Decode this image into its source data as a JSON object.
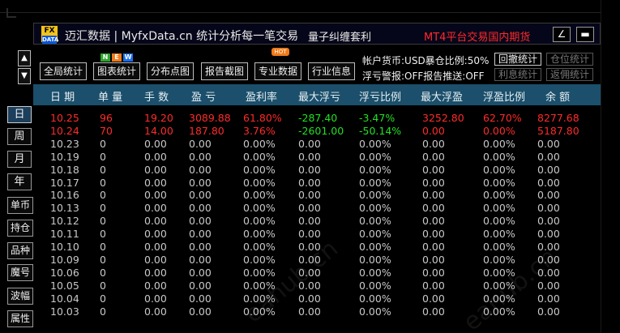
{
  "titlebar": {
    "logo_top": "FX",
    "logo_bottom": "DATA",
    "title": "迈汇数据 | MyfxData.cn  统计分析每一笔交易",
    "quant": "量子纠缠套利",
    "mt4": "MT4平台交易国内期货",
    "btn_edit_icon": "∠",
    "btn_min_icon": "▬"
  },
  "toolbar": {
    "buttons": [
      "全局统计",
      "图表统计",
      "分布点图",
      "报告截图",
      "专业数据",
      "行业信息"
    ],
    "badge_n": "N",
    "badge_e": "E",
    "badge_w": "W",
    "badge_hot": "HOT",
    "info_line1": "帐户货币:USD暴仓比例:50%",
    "info_line2": "浮亏警报:OFF报告推送:OFF",
    "btn_hui_che": "回撤统计",
    "btn_cang_wei": "仓位统计",
    "btn_li_xi": "利息统计",
    "btn_fan_yong": "返佣统计",
    "arrow_up": "▲",
    "arrow_down": "▼"
  },
  "sidebar": {
    "tabs": [
      "日",
      "周",
      "月",
      "年",
      "单币",
      "持仓",
      "品种",
      "魔号",
      "波幅",
      "属性"
    ]
  },
  "table": {
    "headers": [
      "日 期",
      "单 量",
      "手 数",
      "盈 亏",
      "盈利率",
      "最大浮亏",
      "浮亏比例",
      "最大浮盈",
      "浮盈比例",
      "余 额"
    ],
    "rows": [
      {
        "date": "10.25",
        "orders": "96",
        "lots": "19.20",
        "pnl": "3089.88",
        "rate": "61.80%",
        "maxloss": "-287.40",
        "lossratio": "-3.47%",
        "maxprofit": "3252.80",
        "profitratio": "62.70%",
        "balance": "8277.68"
      },
      {
        "date": "10.24",
        "orders": "70",
        "lots": "14.00",
        "pnl": "187.80",
        "rate": "3.76%",
        "maxloss": "-2601.00",
        "lossratio": "-50.14%",
        "maxprofit": "0.00",
        "profitratio": "0.00%",
        "balance": "5187.80"
      },
      {
        "date": "10.23",
        "orders": "0",
        "lots": "0.00",
        "pnl": "0.00",
        "rate": "0.00%",
        "maxloss": "0.00",
        "lossratio": "0.00%",
        "maxprofit": "0.00",
        "profitratio": "0.00%",
        "balance": "0.00"
      },
      {
        "date": "10.19",
        "orders": "0",
        "lots": "0.00",
        "pnl": "0.00",
        "rate": "0.00%",
        "maxloss": "0.00",
        "lossratio": "0.00%",
        "maxprofit": "0.00",
        "profitratio": "0.00%",
        "balance": "0.00"
      },
      {
        "date": "10.18",
        "orders": "0",
        "lots": "0.00",
        "pnl": "0.00",
        "rate": "0.00%",
        "maxloss": "0.00",
        "lossratio": "0.00%",
        "maxprofit": "0.00",
        "profitratio": "0.00%",
        "balance": "0.00"
      },
      {
        "date": "10.17",
        "orders": "0",
        "lots": "0.00",
        "pnl": "0.00",
        "rate": "0.00%",
        "maxloss": "0.00",
        "lossratio": "0.00%",
        "maxprofit": "0.00",
        "profitratio": "0.00%",
        "balance": "0.00"
      },
      {
        "date": "10.16",
        "orders": "0",
        "lots": "0.00",
        "pnl": "0.00",
        "rate": "0.00%",
        "maxloss": "0.00",
        "lossratio": "0.00%",
        "maxprofit": "0.00",
        "profitratio": "0.00%",
        "balance": "0.00"
      },
      {
        "date": "10.13",
        "orders": "0",
        "lots": "0.00",
        "pnl": "0.00",
        "rate": "0.00%",
        "maxloss": "0.00",
        "lossratio": "0.00%",
        "maxprofit": "0.00",
        "profitratio": "0.00%",
        "balance": "0.00"
      },
      {
        "date": "10.12",
        "orders": "0",
        "lots": "0.00",
        "pnl": "0.00",
        "rate": "0.00%",
        "maxloss": "0.00",
        "lossratio": "0.00%",
        "maxprofit": "0.00",
        "profitratio": "0.00%",
        "balance": "0.00"
      },
      {
        "date": "10.11",
        "orders": "0",
        "lots": "0.00",
        "pnl": "0.00",
        "rate": "0.00%",
        "maxloss": "0.00",
        "lossratio": "0.00%",
        "maxprofit": "0.00",
        "profitratio": "0.00%",
        "balance": "0.00"
      },
      {
        "date": "10.10",
        "orders": "0",
        "lots": "0.00",
        "pnl": "0.00",
        "rate": "0.00%",
        "maxloss": "0.00",
        "lossratio": "0.00%",
        "maxprofit": "0.00",
        "profitratio": "0.00%",
        "balance": "0.00"
      },
      {
        "date": "10.09",
        "orders": "0",
        "lots": "0.00",
        "pnl": "0.00",
        "rate": "0.00%",
        "maxloss": "0.00",
        "lossratio": "0.00%",
        "maxprofit": "0.00",
        "profitratio": "0.00%",
        "balance": "0.00"
      },
      {
        "date": "10.06",
        "orders": "0",
        "lots": "0.00",
        "pnl": "0.00",
        "rate": "0.00%",
        "maxloss": "0.00",
        "lossratio": "0.00%",
        "maxprofit": "0.00",
        "profitratio": "0.00%",
        "balance": "0.00"
      },
      {
        "date": "10.05",
        "orders": "0",
        "lots": "0.00",
        "pnl": "0.00",
        "rate": "0.00%",
        "maxloss": "0.00",
        "lossratio": "0.00%",
        "maxprofit": "0.00",
        "profitratio": "0.00%",
        "balance": "0.00"
      },
      {
        "date": "10.04",
        "orders": "0",
        "lots": "0.00",
        "pnl": "0.00",
        "rate": "0.00%",
        "maxloss": "0.00",
        "lossratio": "0.00%",
        "maxprofit": "0.00",
        "profitratio": "0.00%",
        "balance": "0.00"
      },
      {
        "date": "10.03",
        "orders": "0",
        "lots": "0.00",
        "pnl": "0.00",
        "rate": "0.00%",
        "maxloss": "0.00",
        "lossratio": "0.00%",
        "maxprofit": "0.00",
        "profitratio": "0.00%",
        "balance": "0.00"
      }
    ]
  },
  "watermark": "eahub.cn",
  "colors": {
    "header_bg": "#1b4f6b",
    "positive": "#ff2a2a",
    "negative": "#22e022",
    "neutral": "#c8c8c8",
    "accent_red": "#ff2a2a",
    "logo_yellow": "#f2c21a"
  }
}
